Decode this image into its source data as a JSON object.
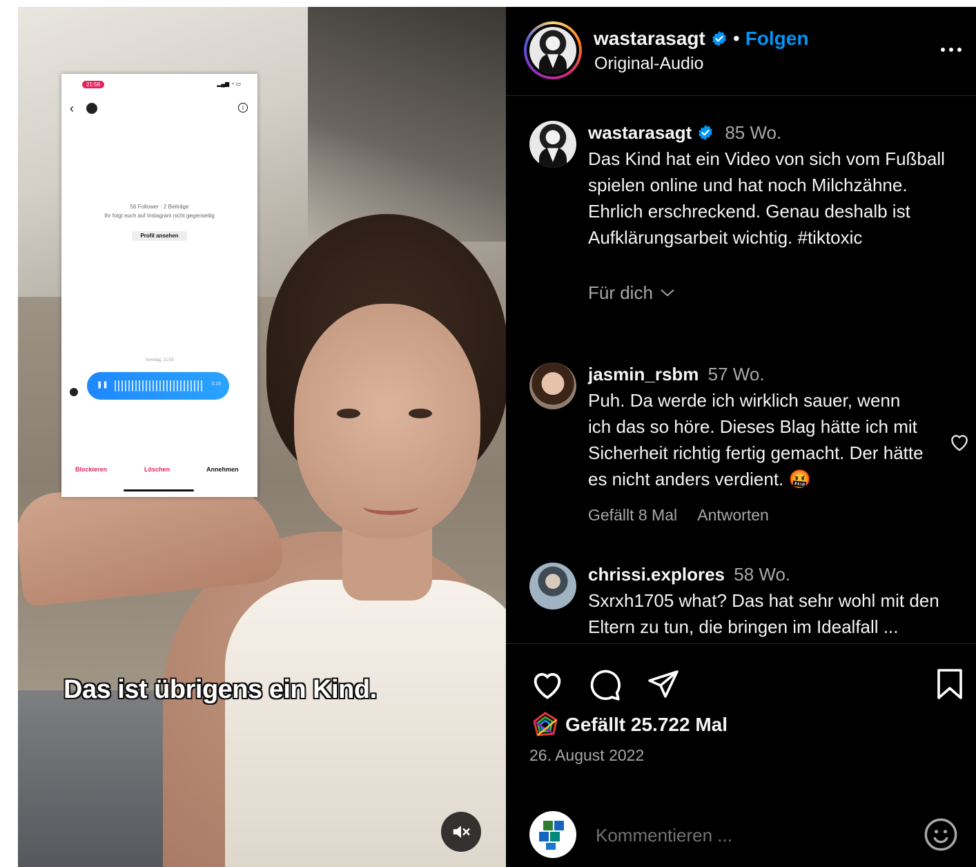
{
  "video": {
    "subtitle": "Das ist übrigens ein Kind.",
    "mute_icon": "speaker-muted-icon",
    "embedded_screenshot": {
      "status_time": "21:58",
      "meta_line1": "56 Follower · 2 Beiträge",
      "meta_line2": "Ihr folgt euch auf Instagram nicht gegenseitig",
      "profile_button": "Profil ansehen",
      "day_label": "Sonntag, 21:03",
      "voice_duration": "0:15",
      "actions": [
        "Blockieren",
        "Löschen",
        "Annehmen"
      ]
    }
  },
  "header": {
    "username": "wastarasagt",
    "separator": "•",
    "follow_label": "Folgen",
    "audio_label": "Original-Audio",
    "more_icon": "more-horizontal-icon"
  },
  "caption": {
    "username": "wastarasagt",
    "age": "85 Wo.",
    "text": "Das Kind hat ein Video von sich vom Fußball spielen online und hat noch Milchzähne. Ehrlich erschreckend. Genau deshalb ist Aufklärungsarbeit wichtig. #tiktoxic",
    "filter_label": "Für dich"
  },
  "comments": [
    {
      "username": "jasmin_rsbm",
      "age": "57 Wo.",
      "text": "Puh. Da werde ich wirklich sauer, wenn ich das so höre. Dieses Blag hätte ich mit Sicherheit richtig fertig gemacht. Der hätte es nicht anders verdient. 🤬",
      "likes": "Gefällt 8 Mal",
      "reply": "Antworten"
    },
    {
      "username": "chrissi.explores",
      "age": "58 Wo.",
      "text": "Sxrxh1705 what? Das hat sehr wohl mit den Eltern zu tun, die bringen im Idealfall ..."
    }
  ],
  "actions": {
    "like_icon": "heart-icon",
    "comment_icon": "comment-icon",
    "share_icon": "send-icon",
    "save_icon": "bookmark-icon"
  },
  "likes_text": "Gefällt 25.722 Mal",
  "date": "26. August 2022",
  "comment_input": {
    "placeholder": "Kommentieren ...",
    "emoji_icon": "smiley-icon"
  },
  "colors": {
    "background": "#000000",
    "accent_blue": "#0095f6",
    "muted_text": "#a8a8a8",
    "divider": "#262626"
  }
}
